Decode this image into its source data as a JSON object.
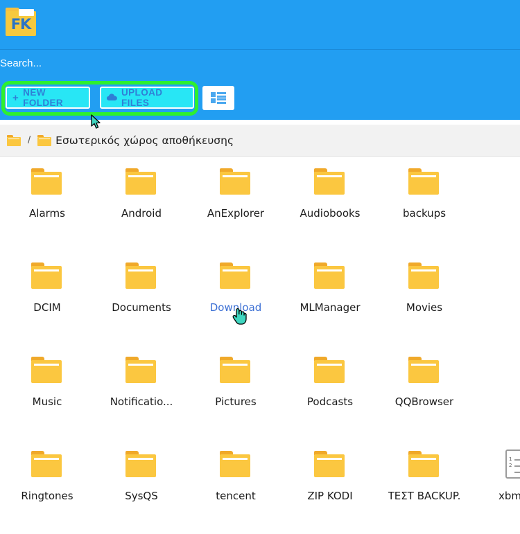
{
  "app": {
    "logo_text": "FK",
    "logo_name": "file-commander-logo"
  },
  "search": {
    "value": "",
    "placeholder": "Search..."
  },
  "toolbar": {
    "new_folder_label": "NEW FOLDER",
    "new_folder_glyph": "+",
    "upload_files_label": "UPLOAD FILES",
    "upload_files_glyph": "☁",
    "view_toggle_name": "list-view-icon"
  },
  "breadcrumb": {
    "root_icon": "folder-icon",
    "separator": "/",
    "current_icon": "folder-icon",
    "current_label": "Εσωτερικός χώρος αποθήκευσης"
  },
  "colors": {
    "header_blue": "#229ef2",
    "button_cyan": "#28e6f5",
    "button_text_blue": "#2f7fd6",
    "folder_yellow": "#fbc740",
    "folder_tab_yellow": "#f0a92a",
    "highlight_green": "#2ef02e",
    "link_blue": "#3b6fd4",
    "breadcrumb_grey": "#f2f2f2",
    "cursor_teal": "#3fd6c0"
  },
  "grid": {
    "rows": [
      [
        {
          "label": "Alarms",
          "type": "folder"
        },
        {
          "label": "Android",
          "type": "folder"
        },
        {
          "label": "AnExplorer",
          "type": "folder"
        },
        {
          "label": "Audiobooks",
          "type": "folder"
        },
        {
          "label": "backups",
          "type": "folder"
        }
      ],
      [
        {
          "label": "DCIM",
          "type": "folder"
        },
        {
          "label": "Documents",
          "type": "folder"
        },
        {
          "label": "Download",
          "type": "folder",
          "highlighted": true,
          "link": true
        },
        {
          "label": "MLManager",
          "type": "folder"
        },
        {
          "label": "Movies",
          "type": "folder"
        }
      ],
      [
        {
          "label": "Music",
          "type": "folder"
        },
        {
          "label": "Notificatio...",
          "type": "folder"
        },
        {
          "label": "Pictures",
          "type": "folder"
        },
        {
          "label": "Podcasts",
          "type": "folder"
        },
        {
          "label": "QQBrowser",
          "type": "folder"
        }
      ],
      [
        {
          "label": "Ringtones",
          "type": "folder"
        },
        {
          "label": "SysQS",
          "type": "folder"
        },
        {
          "label": "tencent",
          "type": "folder"
        },
        {
          "label": "ZIP KODI",
          "type": "folder",
          "highlighted": true
        },
        {
          "label": "ΤΕΣΤ BACKUP.",
          "type": "folder",
          "highlighted": true
        },
        {
          "label": "xbmc_e",
          "type": "file",
          "file_icon": "log-file-icon",
          "line_numbers": [
            "1",
            "2"
          ]
        }
      ]
    ]
  },
  "cursors": {
    "arrow_name": "mouse-pointer-arrow",
    "hand_name": "mouse-pointer-hand"
  },
  "annotations": {
    "toolbar_box": "highlight-box-toolbar",
    "download_box": "highlight-box-download",
    "last_row_box": "highlight-box-zip-kodi-test-backup"
  }
}
